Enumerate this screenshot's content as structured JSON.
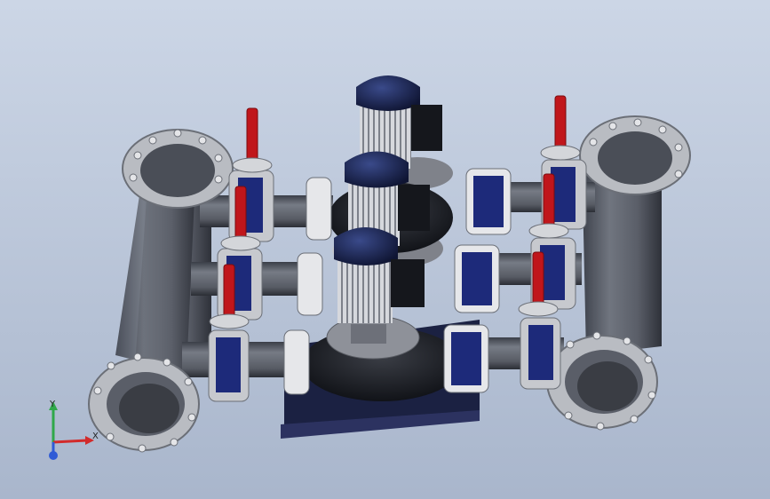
{
  "view": {
    "background_top": "#ccd6e6",
    "background_bottom": "#a9b6cc"
  },
  "triad": {
    "x_label": "X",
    "y_label": "Y",
    "x_color": "#d22b2b",
    "y_color": "#2fa84a",
    "z_color": "#2f5bd6"
  },
  "model": {
    "pump_count": 3,
    "valve_handle_color": "#c0161b",
    "pipe_color": "#5a5f6b",
    "motor_color": "#16204a",
    "flange_color": "#b9bcc2",
    "base_color": "#1b2142"
  }
}
